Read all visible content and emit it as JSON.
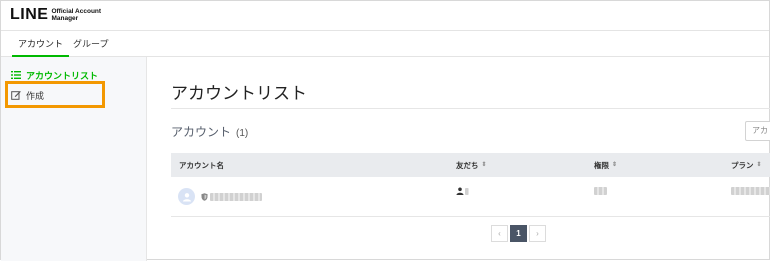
{
  "header": {
    "logo_main": "LINE",
    "logo_sub": "Official Account Manager"
  },
  "tabs": [
    {
      "label": "アカウント",
      "active": true
    },
    {
      "label": "グループ",
      "active": false
    }
  ],
  "sidebar": {
    "items": [
      {
        "label": "アカウントリスト",
        "active": true,
        "icon": "list-icon"
      },
      {
        "label": "作成",
        "active": false,
        "icon": "edit-icon"
      }
    ]
  },
  "main": {
    "title": "アカウントリスト",
    "section_title": "アカウント",
    "section_count": "(1)",
    "add_button_label": "アカ",
    "table": {
      "columns": [
        "アカウント名",
        "友だち",
        "権限",
        "プラン"
      ],
      "sort_glyph": "⇕"
    },
    "pagination": {
      "prev": "‹",
      "current": "1",
      "next": "›"
    }
  },
  "colors": {
    "accent": "#00b900",
    "highlight": "#f39800",
    "pager_active": "#4a5566"
  }
}
